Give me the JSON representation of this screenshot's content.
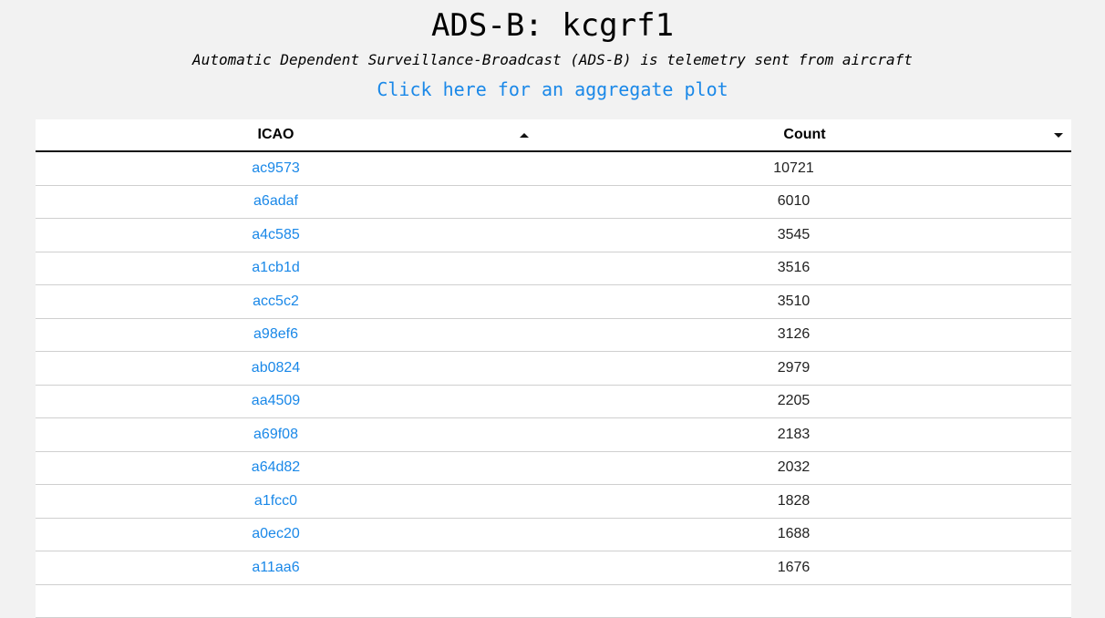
{
  "header": {
    "title": "ADS-B: kcgrf1",
    "subtitle": "Automatic Dependent Surveillance-Broadcast (ADS-B) is telemetry sent from aircraft",
    "aggregate_link": "Click here for an aggregate plot"
  },
  "table": {
    "columns": [
      {
        "label": "ICAO",
        "sort": "ascending"
      },
      {
        "label": "Count",
        "sort": "descending"
      }
    ],
    "rows": [
      {
        "icao": "ac9573",
        "count": "10721"
      },
      {
        "icao": "a6adaf",
        "count": "6010"
      },
      {
        "icao": "a4c585",
        "count": "3545"
      },
      {
        "icao": "a1cb1d",
        "count": "3516"
      },
      {
        "icao": "acc5c2",
        "count": "3510"
      },
      {
        "icao": "a98ef6",
        "count": "3126"
      },
      {
        "icao": "ab0824",
        "count": "2979"
      },
      {
        "icao": "aa4509",
        "count": "2205"
      },
      {
        "icao": "a69f08",
        "count": "2183"
      },
      {
        "icao": "a64d82",
        "count": "2032"
      },
      {
        "icao": "a1fcc0",
        "count": "1828"
      },
      {
        "icao": "a0ec20",
        "count": "1688"
      },
      {
        "icao": "a11aa6",
        "count": "1676"
      },
      {
        "icao": "",
        "count": ""
      }
    ]
  },
  "colors": {
    "background": "#f2f2f2",
    "link": "#1a88e8",
    "row_divider": "#cfcfcf"
  }
}
